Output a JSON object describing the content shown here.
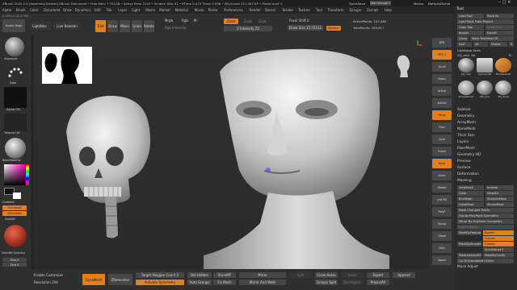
{
  "window": {
    "title": "ZBrush 2022.0.4 [Hamming Sander]  ZBrush Document   • Free Mem 7.751GB • Active Mem 2193 • Scratch Disk 41 • RTime 0.473 Timer 0.098 • PolyCount 251,287 KP • MeshCount 1",
    "quicksave": "QuickSave",
    "see_through": "See-through 0",
    "menus_label": "Menus",
    "default_script": "DefaultZScript"
  },
  "menubar": [
    "Alpha",
    "Brush",
    "Color",
    "Document",
    "Draw",
    "Dynamics",
    "Edit",
    "File",
    "Layer",
    "Light",
    "Macro",
    "Marker",
    "Material",
    "Movie",
    "Picker",
    "Preferences",
    "Render",
    "Stencil",
    "Stroke",
    "Texture",
    "Tool",
    "Transform",
    "Zplugin",
    "Zscript",
    "Help"
  ],
  "coords": "0.1850,0.42,0.990",
  "toolbar": {
    "home": "Home Page",
    "lightbox": "LightBox",
    "live_boolean": "Live Boolean",
    "edit": "Edit",
    "draw": "Draw",
    "move": "Move",
    "scale": "Scale",
    "rotate": "Rotate",
    "mrgb": "Mrgb",
    "rgb": "Rgb",
    "m": "M",
    "rgb_intensity": "Rgb Intensity",
    "zadd": "Zadd",
    "zsub": "Zsub",
    "zcut": "Zcut",
    "z_intensity": "Z Intensity 25",
    "focal_shift": "Focal Shift 0",
    "draw_size": "Draw Size 15.55142",
    "active_points": "ActivePoints: 247,485",
    "total_points": "TotalPoints: 263,617",
    "dynamic": "Dynamic"
  },
  "left_shelf": {
    "brush_label": "Standard",
    "stroke_label": "Dots",
    "alpha_label": "Alpha Off",
    "texture_label": "Texture Off",
    "material_label": "BasicMaterial",
    "gradient_label": "Gradient",
    "switch_color": "SwitchColor",
    "alternate": "Alternate",
    "thumbnail": "Thumbnail",
    "silhouette": "Silhouette",
    "double": "Double",
    "select_lasso": "SelectRt SelectLa",
    "zero_s": "Zero S",
    "zero_a": "Zero A"
  },
  "right_shelf": [
    "BPR",
    "SPix 3",
    "Scroll",
    "Zoom",
    "Actual",
    "AAHalf",
    "Persp",
    "Floor",
    "Local",
    "Frame",
    "Move",
    "Scale",
    "Rotate",
    "Line Fill",
    "PolyF",
    "Transp",
    "Ghost",
    "Solo",
    "Xpose"
  ],
  "tool_panel": {
    "title": "Tool",
    "load_tool": "Load Tool",
    "save_as": "Save As",
    "load_tools_project": "Load Tools From Project",
    "copy_tool": "Copy Tool",
    "paste_tool": "Paste Tool",
    "import": "Import",
    "export": "Export",
    "clone": "Clone",
    "make_polymesh": "Make PolyMesh3D",
    "goz": "GoZ",
    "all": "All",
    "visible": "Visible",
    "r": "R",
    "lightbox_tools": "Lightbox▸ Tools",
    "current_tool": "ZQ_mid. 48",
    "r2": "R",
    "thumbs": [
      "ZQ_mid.",
      "Cylinder3D",
      "PolyMesh3D",
      "SimpleBrush",
      "ZQ_mid",
      "ZQ_Skull"
    ],
    "sections": [
      "Subtool",
      "Geometry",
      "ArrayMesh",
      "NanoMesh",
      "Thick Skin",
      "Layers",
      "FiberMesh",
      "Geometry HD",
      "Preview",
      "Surface",
      "Deformation",
      "Masking"
    ],
    "masking": {
      "viewmask": "ViewMask",
      "inverse": "Inverse",
      "clear": "Clear",
      "maskall": "MaskAll",
      "blurmask": "BlurMask",
      "sharpenmask": "SharpenMask",
      "growmask": "GrowMask",
      "shrinkmask": "ShrinkMask",
      "mask_changed": "Mask Changed Points",
      "flip_polypaint": "Flip By PolyPaint Symmetry",
      "mirror_symmetry": "Mirror By PolyPaint Symmetry",
      "create_alpha": "Create Alpha",
      "border": "Border",
      "groups": "Groups",
      "crease": "Crease",
      "mask_by_feature": "MaskByFeature",
      "mask_by_smoothness": "MaskBySmoothness",
      "shell_adjust": "ShellAdjust 2",
      "mask_ao": "MaskAmbientOcclusion",
      "mask_cavity": "MaskByCavity",
      "mask_unmasked": "Go To Unmasked Center",
      "mask_adjust": "Mask Adjust"
    }
  },
  "bottom_bar": {
    "enable_customize": "Enable Customize",
    "resolution": "Resolution 204",
    "dynamesh": "DynaMesh",
    "zremesher": "ZRemesher",
    "target_polycount": "Target Polygon Count 5",
    "activate_symmetry": "Activate Symmetry",
    "del_hidden": "Del Hidden",
    "stored": "StoreMT",
    "auto_groups": "Auto Groups",
    "fix_mesh": "Fix Mesh",
    "mirror": "Mirror",
    "mirror_weld": "Mirror And Weld",
    "split": "Split",
    "close_holes": "Close Holes",
    "groups_split": "Groups Split",
    "del_higher": "Del Higher",
    "export": "Export",
    "project_all": "ProjectAll",
    "append": "Append",
    "inner": "Inner"
  },
  "colors": {
    "accent": "#e0801f",
    "panel": "#2f2f2f",
    "button": "#474747"
  }
}
